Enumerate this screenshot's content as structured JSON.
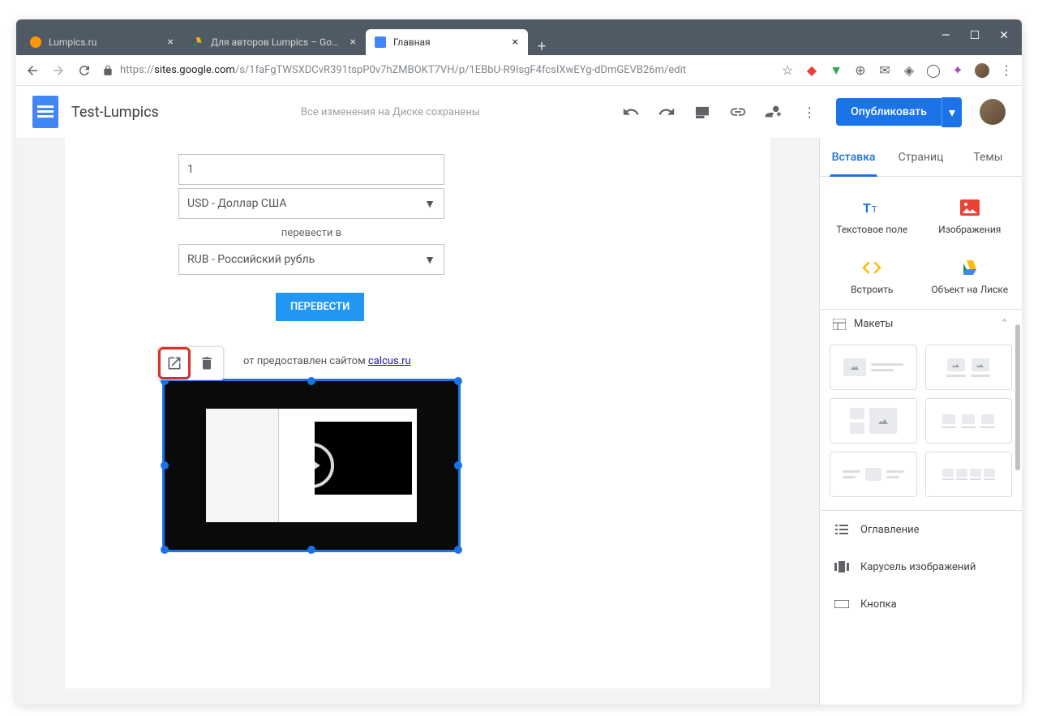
{
  "window": {
    "tabs": [
      {
        "title": "Lumpics.ru"
      },
      {
        "title": "Для авторов Lumpics – Google Д"
      },
      {
        "title": "Главная"
      }
    ]
  },
  "address": {
    "url_prefix": "https://",
    "url_host": "sites.google.com",
    "url_path": "/s/1faFgTWSXDCvR391tspP0v7hZMBOKT7VH/p/1EBbU-R9IsgF4fcsIXwEYg-dDmGEVB26m/edit"
  },
  "header": {
    "doc_title": "Test-Lumpics",
    "save_status": "Все изменения на Диске сохранены",
    "publish": "Опубликовать"
  },
  "canvas": {
    "amount": "1",
    "from_currency": "USD - Доллар США",
    "convert_label": "перевести в",
    "to_currency": "RUB - Российский рубль",
    "convert_btn": "ПЕРЕВЕСТИ",
    "credit_text": "от предоставлен сайтом ",
    "credit_link": "calcus.ru"
  },
  "sidepanel": {
    "tabs": {
      "insert": "Вставка",
      "pages": "Страниц",
      "themes": "Темы"
    },
    "insert_items": {
      "text": "Текстовое поле",
      "images": "Изображения",
      "embed": "Встроить",
      "drive": "Объект на Лиске"
    },
    "layouts_header": "Макеты",
    "components": {
      "toc": "Оглавление",
      "carousel": "Карусель изображений",
      "button": "Кнопка"
    }
  }
}
